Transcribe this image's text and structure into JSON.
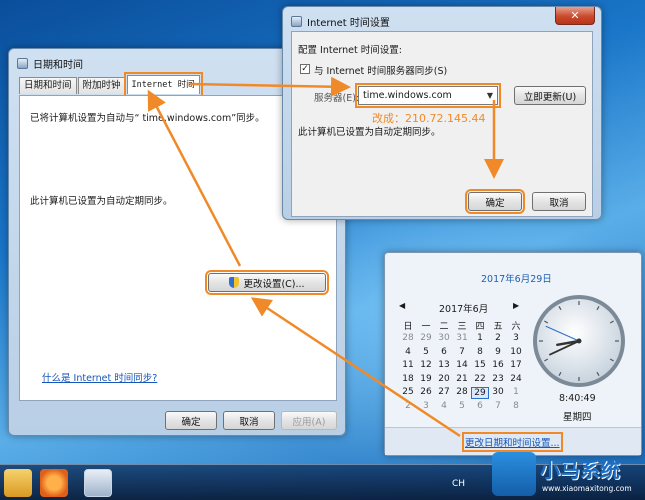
{
  "dt_window": {
    "title": "日期和时间",
    "tabs": [
      "日期和时间",
      "附加时钟",
      "Internet 时间"
    ],
    "sync_text": "已将计算机设置为自动与“ time.windows.com”同步。",
    "schedule_text": "此计算机已设置为自动定期同步。",
    "change_button": "更改设置(C)...",
    "help_link": "什么是 Internet 时间同步?",
    "ok": "确定",
    "cancel": "取消",
    "apply": "应用(A)"
  },
  "its_window": {
    "title": "Internet 时间设置",
    "config_label": "配置 Internet 时间设置:",
    "sync_checkbox": "与 Internet 时间服务器同步(S)",
    "server_label": "服务器(E):",
    "server_value": "time.windows.com",
    "update_button": "立即更新(U)",
    "annotation": "改成：210.72.145.44",
    "schedule_text": "此计算机已设置为自动定期同步。",
    "ok": "确定",
    "cancel": "取消"
  },
  "clock_popup": {
    "date_title": "2017年6月29日",
    "month_label": "2017年6月",
    "weekdays": [
      "日",
      "一",
      "二",
      "三",
      "四",
      "五",
      "六"
    ],
    "weeks": [
      [
        "28",
        "29",
        "30",
        "31",
        "1",
        "2",
        "3"
      ],
      [
        "4",
        "5",
        "6",
        "7",
        "8",
        "9",
        "10"
      ],
      [
        "11",
        "12",
        "13",
        "14",
        "15",
        "16",
        "17"
      ],
      [
        "18",
        "19",
        "20",
        "21",
        "22",
        "23",
        "24"
      ],
      [
        "25",
        "26",
        "27",
        "28",
        "29",
        "30",
        "1"
      ],
      [
        "2",
        "3",
        "4",
        "5",
        "6",
        "7",
        "8"
      ]
    ],
    "time": "8:40:49",
    "weekday_label": "星期四",
    "change_link": "更改日期和时间设置..."
  },
  "taskbar": {
    "lang": "CH"
  },
  "watermark": {
    "brand": "小马系统",
    "url": "www.xiaomaxitong.com"
  },
  "colors": {
    "annotation": "#f08a28",
    "link": "#1556b8"
  }
}
